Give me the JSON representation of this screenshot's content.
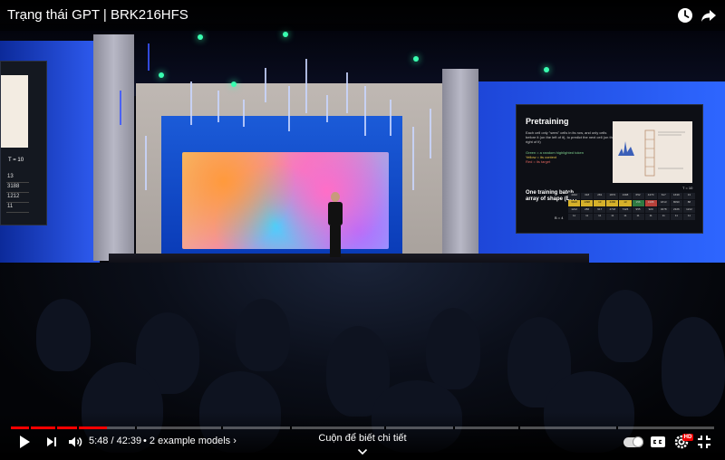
{
  "window": {
    "title": "Trạng thái GPT | BRK216HFS"
  },
  "top_actions": {
    "watch_later_icon": "clock-icon",
    "share_icon": "share-arrow-icon"
  },
  "slide_left": {
    "t_label": "T = 10",
    "rows": [
      "13",
      "3188",
      "1212",
      "11"
    ]
  },
  "slide_right": {
    "title": "Pretraining",
    "body": "Each cell only \"sees\" cells in its row, and only cells before it (on the left of it), to predict the next cell (on the right of it)",
    "legend_green": "Green = a random highlighted token",
    "legend_yellow": "Yellow = its context",
    "legend_red": "Red = its target",
    "batch_label": "One training batch, array of shape (B,T)",
    "t_label": "T = 10",
    "b_label": "B = 4",
    "grid": [
      [
        "4342",
        "318",
        "281",
        "1872",
        "1398",
        "652",
        "4470",
        "617",
        "1639",
        "13"
      ],
      [
        "9628",
        "1398",
        "13",
        "4466",
        "13",
        "156",
        "3188",
        "1813",
        "8090",
        "88"
      ],
      [
        "1212",
        "286",
        "917",
        "4718",
        "7426",
        "955",
        "920",
        "3278",
        "2326",
        "1212"
      ],
      [
        "11",
        "11",
        "11",
        "11",
        "11",
        "11",
        "11",
        "11",
        "11",
        "11"
      ]
    ]
  },
  "player": {
    "current_time": "5:48",
    "duration": "42:39",
    "time_text": "5:48 / 42:39",
    "chapter_text": "• 2 example models",
    "chapter_chevron": "›",
    "scroll_hint": "Cuộn để biết chi tiết",
    "notification_badge": "HD",
    "progress": 0.136,
    "colors": {
      "progress": "#ff0000",
      "badge": "#e00000"
    }
  }
}
